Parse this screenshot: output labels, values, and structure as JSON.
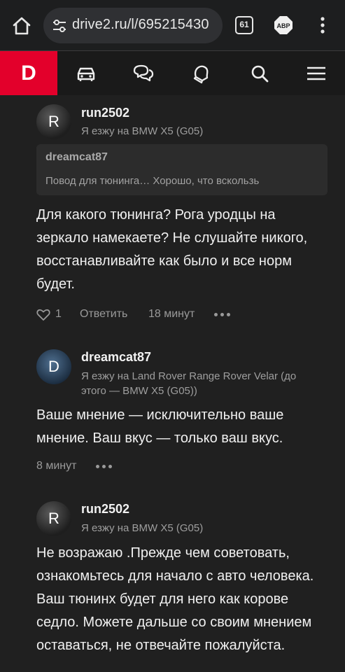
{
  "browser": {
    "url": "drive2.ru/l/695215430",
    "tab_count": "61",
    "adblock_label": "ABP"
  },
  "site": {
    "logo_letter": "D",
    "nav_icons": [
      "car-icon",
      "chat-icon",
      "bell-icon",
      "search-icon",
      "hamburger-menu-icon"
    ],
    "accent_color": "#e3002b"
  },
  "comments": [
    {
      "avatar_letter": "R",
      "author": "run2502",
      "car": "Я езжу на BMW X5 (G05)",
      "quote": {
        "author": "dreamcat87",
        "text": "Повод для тюнинга… Хорошо, что вскользь"
      },
      "text": "Для какого тюнинга? Рога уродцы на зеркало намекаете? Не слушайте никого, восстанавливайте как было и все норм будет.",
      "likes": "1",
      "reply_label": "Ответить",
      "time": "18 минут"
    },
    {
      "avatar_letter": "D",
      "author": "dreamcat87",
      "car": "Я езжу на Land Rover Range Rover Velar (до этого — BMW X5 (G05))",
      "text": "Ваше мнение — исключительно ваше мнение. Ваш вкус — только ваш вкус.",
      "time": "8 минут"
    },
    {
      "avatar_letter": "R",
      "author": "run2502",
      "car": "Я езжу на BMW X5 (G05)",
      "text": "Не возражаю .Прежде чем советовать, ознакомьтесь для начало с авто человека. Ваш тюнинх будет для него как корове седло. Можете дальше со своим мнением оставаться, не отвечайте пожалуйста."
    }
  ]
}
